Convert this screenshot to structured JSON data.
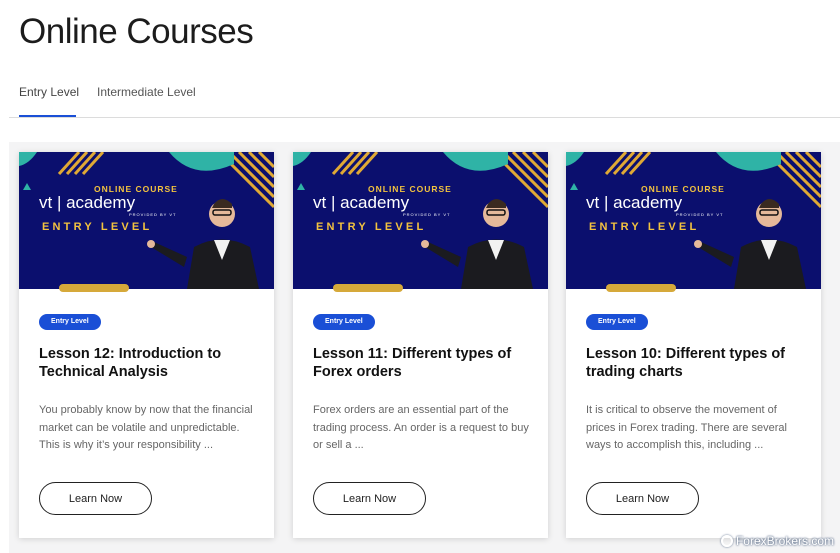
{
  "page": {
    "title": "Online Courses"
  },
  "tabs": [
    {
      "label": "Entry Level",
      "active": true
    },
    {
      "label": "Intermediate Level",
      "active": false
    }
  ],
  "courses": [
    {
      "image": {
        "line1": "ONLINE COURSE",
        "logo": "vt | academy",
        "provided": "PROVIDED BY VT",
        "level": "ENTRY LEVEL"
      },
      "badge": "Entry Level",
      "title": "Lesson 12: Introduction to Technical Analysis",
      "description": "You probably know by now that the financial market can be volatile and unpredictable. This is why it’s your responsibility ...",
      "button": "Learn Now"
    },
    {
      "image": {
        "line1": "ONLINE COURSE",
        "logo": "vt | academy",
        "provided": "PROVIDED BY VT",
        "level": "ENTRY LEVEL"
      },
      "badge": "Entry Level",
      "title": "Lesson 11: Different types of Forex orders",
      "description": "Forex orders are an essential part of the trading process. An order is a request to buy or sell a ...",
      "button": "Learn Now"
    },
    {
      "image": {
        "line1": "ONLINE COURSE",
        "logo": "vt | academy",
        "provided": "PROVIDED BY VT",
        "level": "ENTRY LEVEL"
      },
      "badge": "Entry Level",
      "title": "Lesson 10: Different types of trading charts",
      "description": "It is critical to observe the movement of prices in Forex trading. There are several ways to accomplish this, including ...",
      "button": "Learn Now"
    }
  ],
  "watermark": {
    "text": "ForexBrokers.com"
  },
  "colors": {
    "accent": "#1a4fd6",
    "banner": "#0b0f6e",
    "gold": "#f3c33f"
  }
}
